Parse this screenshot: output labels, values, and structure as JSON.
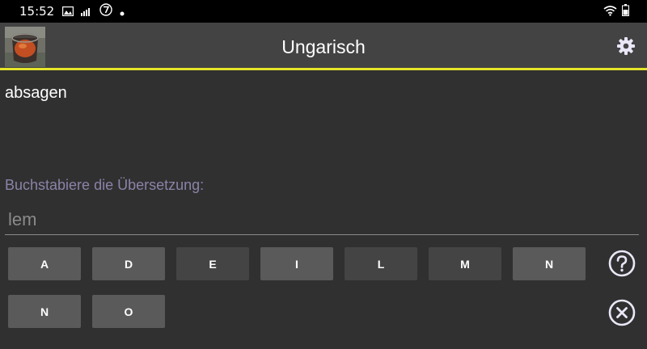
{
  "status_bar": {
    "time": "15:52",
    "left_icons": [
      "image-icon",
      "signal-bars-icon",
      "badge-7-icon",
      "dot-icon"
    ],
    "right_icons": [
      "wifi-icon",
      "battery-icon"
    ]
  },
  "app_bar": {
    "title": "Ungarisch",
    "accent_color": "#e5e52a"
  },
  "prompt": {
    "word": "absagen",
    "instruction": "Buchstabiere die Übersetzung:"
  },
  "answer": {
    "value": "lem"
  },
  "letters": [
    "A",
    "D",
    "E",
    "I",
    "L",
    "M",
    "N",
    "N",
    "O"
  ],
  "actions": {
    "hint_icon": "question-circle-icon",
    "clear_icon": "close-circle-icon"
  }
}
